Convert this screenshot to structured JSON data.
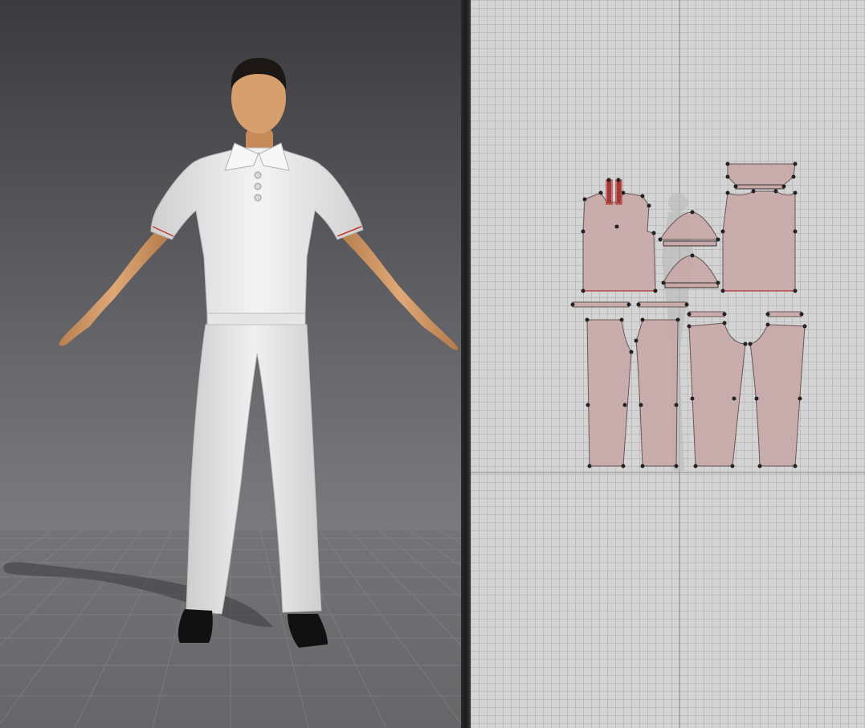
{
  "app": {
    "views": [
      "3d-avatar-view",
      "2d-pattern-view"
    ]
  },
  "viewport_3d": {
    "avatar": "male-avatar-a-pose",
    "garments": [
      "polo-shirt",
      "trousers"
    ],
    "colors": {
      "garment": "#eeeeee",
      "skin": "#d8a070",
      "shoe": "#111111",
      "topstitch": "#c0392b"
    }
  },
  "viewport_2d": {
    "pattern_pieces": [
      "shirt-front-left",
      "shirt-front-right",
      "collar",
      "sleeve-left",
      "sleeve-right",
      "shirt-back",
      "cuff-left",
      "cuff-right",
      "waistband-front-left",
      "waistband-front-right",
      "waistband-back-left",
      "waistband-back-right",
      "trouser-front-left",
      "trouser-front-right",
      "trouser-back-left",
      "trouser-back-right"
    ],
    "colors": {
      "piece_fill": "#c8a7a7",
      "piece_stroke": "#6a5656",
      "point": "#222222",
      "seam_red": "#b83232",
      "grid_axis": "#888888"
    }
  }
}
